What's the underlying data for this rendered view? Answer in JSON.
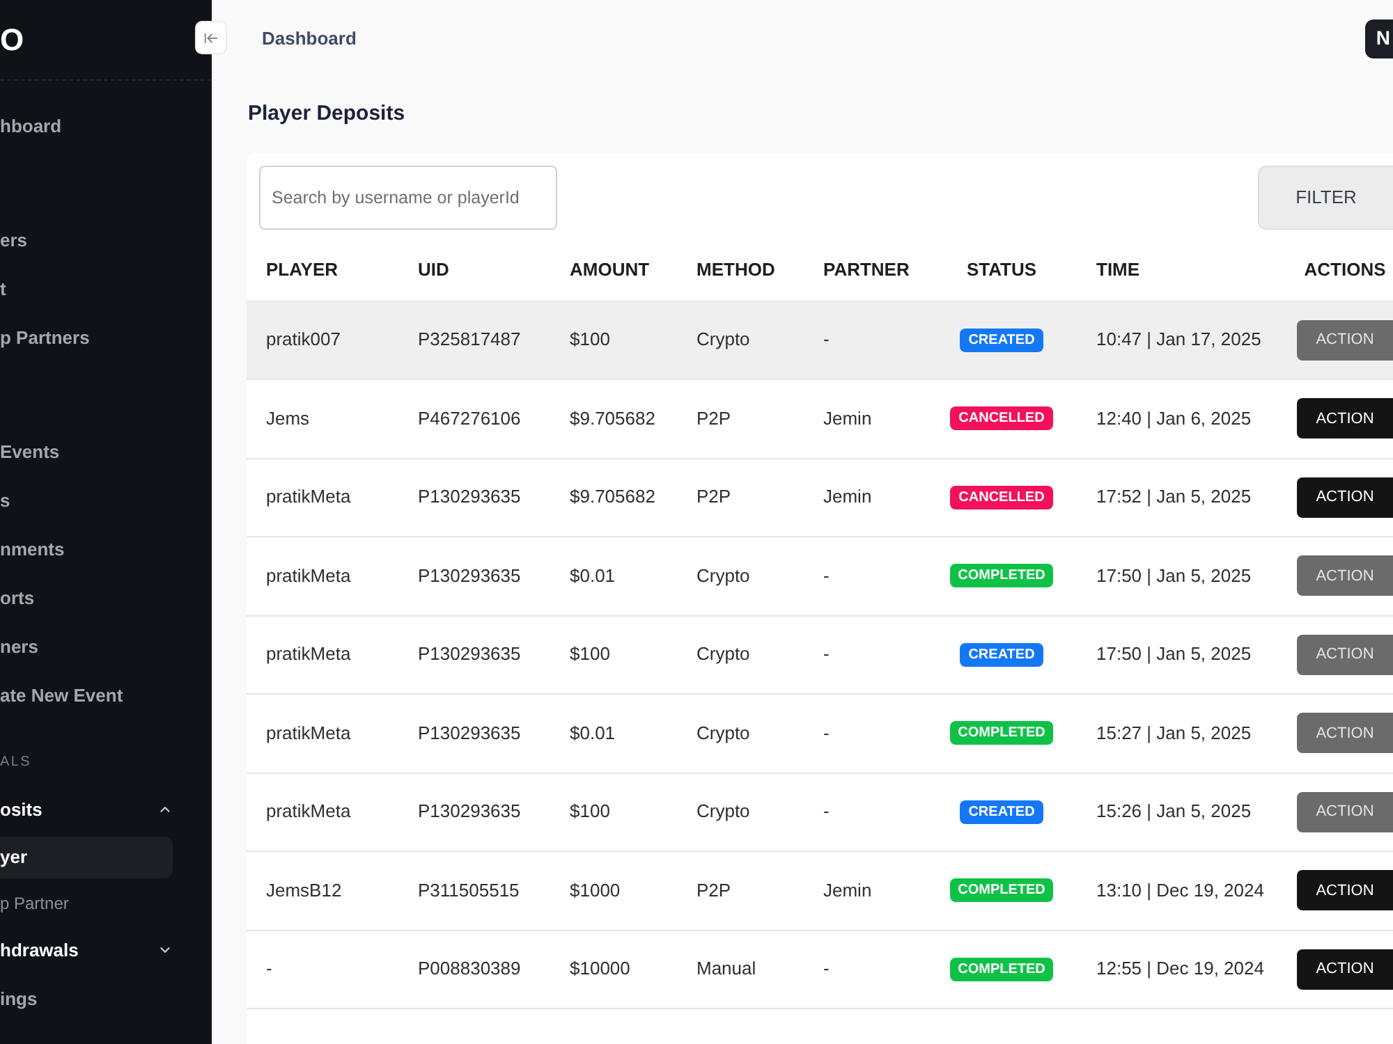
{
  "sidebar": {
    "logo": "O",
    "groups": [
      {
        "items": [
          {
            "label": "hboard",
            "kind": "link"
          }
        ]
      },
      {
        "items": [
          {
            "label": "ers",
            "kind": "link"
          },
          {
            "label": "t",
            "kind": "link"
          },
          {
            "label": "p Partners",
            "kind": "link"
          }
        ]
      },
      {
        "items": [
          {
            "label": "Events",
            "kind": "link"
          },
          {
            "label": "s",
            "kind": "link"
          },
          {
            "label": "nments",
            "kind": "link"
          },
          {
            "label": "orts",
            "kind": "link"
          },
          {
            "label": "ners",
            "kind": "link"
          },
          {
            "label": "ate New Event",
            "kind": "link"
          }
        ]
      },
      {
        "heading": "ALS",
        "items": [
          {
            "label": "osits",
            "kind": "group",
            "expanded": true,
            "children": [
              {
                "label": "yer",
                "selected": true
              },
              {
                "label": "p Partner",
                "selected": false
              }
            ]
          },
          {
            "label": "hdrawals",
            "kind": "group",
            "expanded": false
          },
          {
            "label": "ings",
            "kind": "link"
          }
        ]
      }
    ]
  },
  "header": {
    "breadcrumb": "Dashboard",
    "button": "N"
  },
  "page_title": "Player Deposits",
  "search": {
    "placeholder": "Search by username or playerId"
  },
  "filter_button": "FILTER",
  "table": {
    "columns": [
      "PLAYER",
      "UID",
      "AMOUNT",
      "METHOD",
      "PARTNER",
      "STATUS",
      "TIME",
      "ACTIONS"
    ],
    "rows": [
      {
        "selected": true,
        "player": "pratik007",
        "uid": "P325817487",
        "amount": "$100",
        "method": "Crypto",
        "partner": "-",
        "status": {
          "label": "CREATED",
          "color": "#1478f6"
        },
        "time": "10:47 | Jan 17, 2025",
        "action": {
          "label": "ACTION",
          "disabled": true
        }
      },
      {
        "selected": false,
        "player": "Jems",
        "uid": "P467276106",
        "amount": "$9.705682",
        "method": "P2P",
        "partner": "Jemin",
        "status": {
          "label": "CANCELLED",
          "color": "#f2115a"
        },
        "time": "12:40 | Jan 6, 2025",
        "action": {
          "label": "ACTION",
          "disabled": false
        }
      },
      {
        "selected": false,
        "player": "pratikMeta",
        "uid": "P130293635",
        "amount": "$9.705682",
        "method": "P2P",
        "partner": "Jemin",
        "status": {
          "label": "CANCELLED",
          "color": "#f2115a"
        },
        "time": "17:52 | Jan 5, 2025",
        "action": {
          "label": "ACTION",
          "disabled": false
        }
      },
      {
        "selected": false,
        "player": "pratikMeta",
        "uid": "P130293635",
        "amount": "$0.01",
        "method": "Crypto",
        "partner": "-",
        "status": {
          "label": "COMPLETED",
          "color": "#0fc247"
        },
        "time": "17:50 | Jan 5, 2025",
        "action": {
          "label": "ACTION",
          "disabled": true
        }
      },
      {
        "selected": false,
        "player": "pratikMeta",
        "uid": "P130293635",
        "amount": "$100",
        "method": "Crypto",
        "partner": "-",
        "status": {
          "label": "CREATED",
          "color": "#1478f6"
        },
        "time": "17:50 | Jan 5, 2025",
        "action": {
          "label": "ACTION",
          "disabled": true
        }
      },
      {
        "selected": false,
        "player": "pratikMeta",
        "uid": "P130293635",
        "amount": "$0.01",
        "method": "Crypto",
        "partner": "-",
        "status": {
          "label": "COMPLETED",
          "color": "#0fc247"
        },
        "time": "15:27 | Jan 5, 2025",
        "action": {
          "label": "ACTION",
          "disabled": true
        }
      },
      {
        "selected": false,
        "player": "pratikMeta",
        "uid": "P130293635",
        "amount": "$100",
        "method": "Crypto",
        "partner": "-",
        "status": {
          "label": "CREATED",
          "color": "#1478f6"
        },
        "time": "15:26 | Jan 5, 2025",
        "action": {
          "label": "ACTION",
          "disabled": true
        }
      },
      {
        "selected": false,
        "player": "JemsB12",
        "uid": "P311505515",
        "amount": "$1000",
        "method": "P2P",
        "partner": "Jemin",
        "status": {
          "label": "COMPLETED",
          "color": "#0fc247"
        },
        "time": "13:10 | Dec 19, 2024",
        "action": {
          "label": "ACTION",
          "disabled": false
        }
      },
      {
        "selected": false,
        "player": "-",
        "uid": "P008830389",
        "amount": "$10000",
        "method": "Manual",
        "partner": "-",
        "status": {
          "label": "COMPLETED",
          "color": "#0fc247"
        },
        "time": "12:55 | Dec 19, 2024",
        "action": {
          "label": "ACTION",
          "disabled": false
        }
      }
    ]
  }
}
